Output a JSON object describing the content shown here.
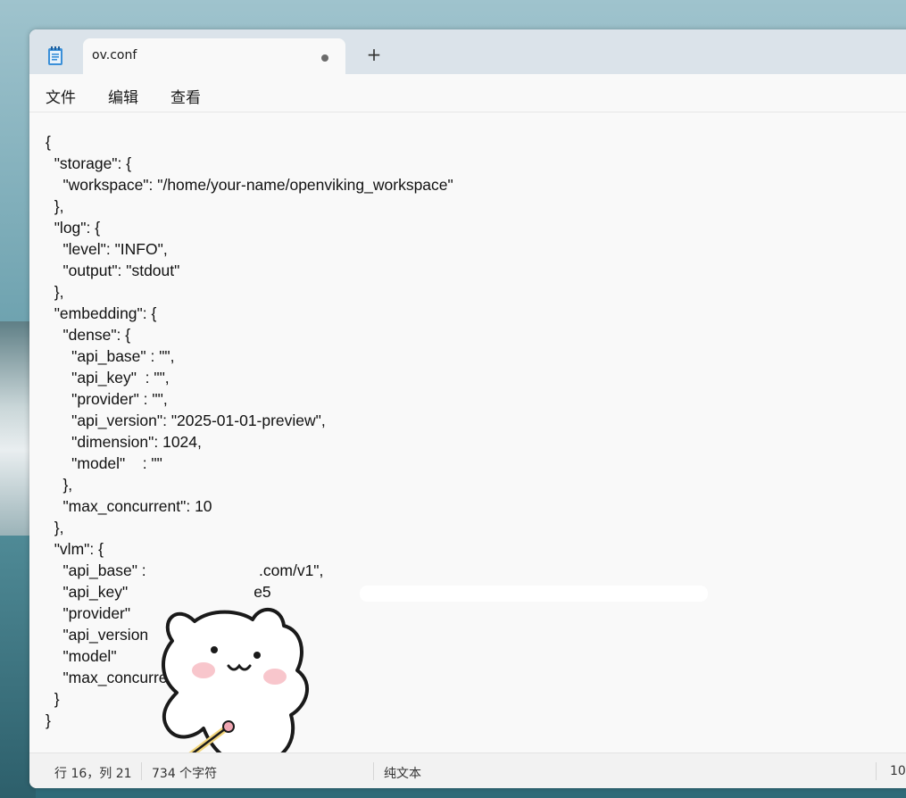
{
  "tab": {
    "title": "ov.conf",
    "icon": "notepad-icon",
    "modified_indicator": "unsaved-dot",
    "new_tab_label": "+"
  },
  "menu": {
    "file": "文件",
    "edit": "编辑",
    "view": "查看"
  },
  "editor": {
    "content": "{\n  \"storage\": {\n    \"workspace\": \"/home/your-name/openviking_workspace\"\n  },\n  \"log\": {\n    \"level\": \"INFO\",\n    \"output\": \"stdout\"\n  },\n  \"embedding\": {\n    \"dense\": {\n      \"api_base\" : \"\",\n      \"api_key\"  : \"\",\n      \"provider\" : \"\",\n      \"api_version\": \"2025-01-01-preview\",\n      \"dimension\": 1024,\n      \"model\"    : \"\"\n    },\n    \"max_concurrent\": 10\n  },\n  \"vlm\": {\n    \"api_base\" :                          .com/v1\",\n    \"api_key\"                             e5                                    8416\",\n    \"provider\"\n    \"api_version                            ew\",\n    \"model\"\n    \"max_concurren\n  }\n}"
  },
  "overlay": {
    "sticker": "bear-sticker"
  },
  "status": {
    "position": "行 16，列 21",
    "char_count": "734 个字符",
    "encoding": "纯文本",
    "zoom": "10"
  }
}
